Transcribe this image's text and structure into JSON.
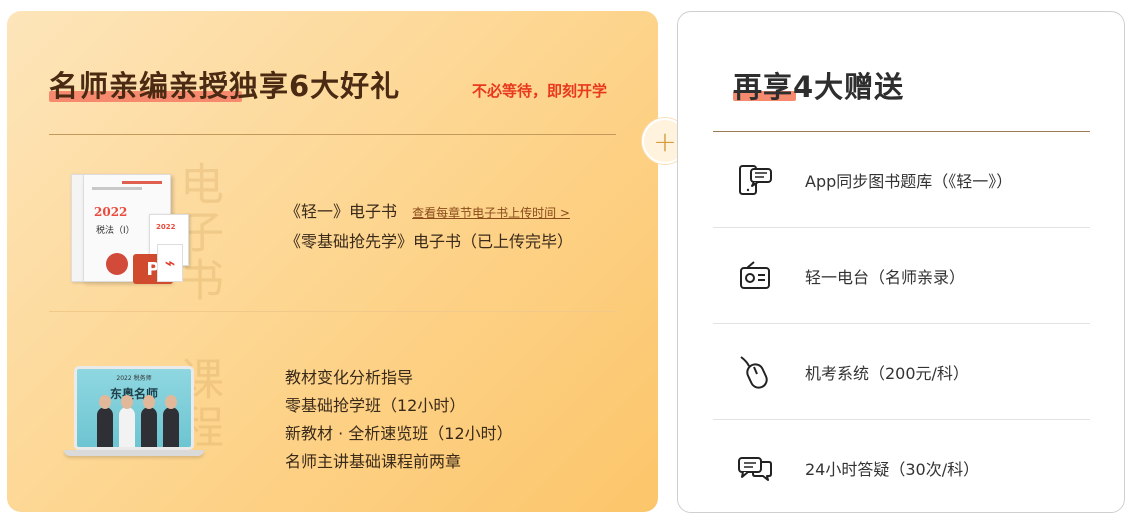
{
  "left": {
    "title": "名师亲编亲授独享6大好礼",
    "subtitle": "不必等待，即刻开学",
    "ebook": {
      "watermark": "电子书",
      "line1": "《轻一》电子书",
      "link": "查看每章节电子书上传时间 >",
      "line2": "《零基础抢先学》电子书（已上传完毕）",
      "book_year": "2022",
      "book_title": "税法（I）",
      "small_year": "2022"
    },
    "course": {
      "watermark": "课程",
      "lines": [
        "教材变化分析指导",
        "零基础抢学班（12小时）",
        "新教材 · 全析速览班（12小时）",
        "名师主讲基础课程前两章"
      ],
      "screen_top": "2022 税务师",
      "screen_name": "东奥名师"
    }
  },
  "plus": "+",
  "right": {
    "title": "再享4大赠送",
    "gifts": [
      {
        "icon": "chat-phone-icon",
        "label": "App同步图书题库（《轻一》）"
      },
      {
        "icon": "radio-icon",
        "label": "轻一电台（名师亲录）"
      },
      {
        "icon": "mouse-icon",
        "label": "机考系统（200元/科）"
      },
      {
        "icon": "chat-bubbles-icon",
        "label": "24小时答疑（30次/科）"
      }
    ]
  }
}
